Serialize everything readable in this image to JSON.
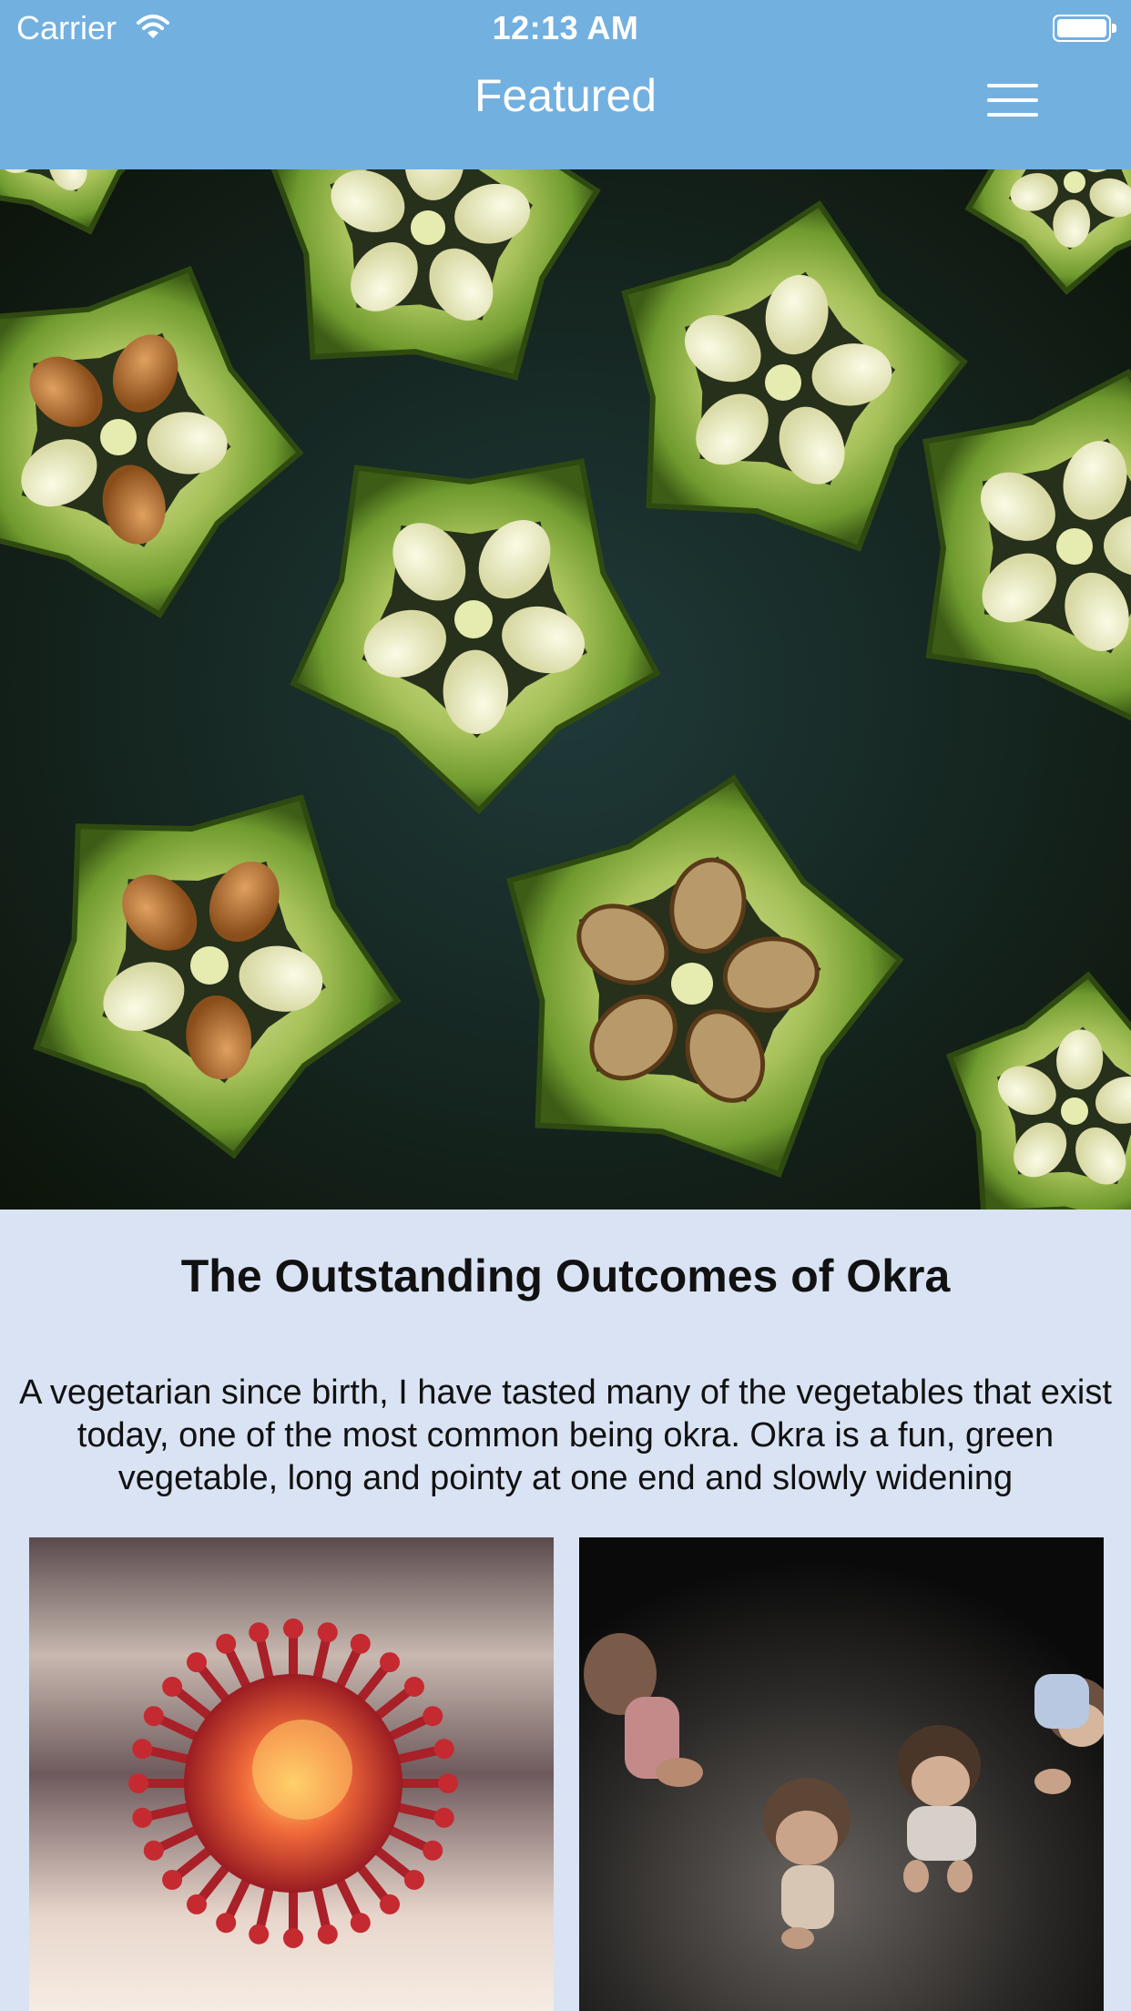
{
  "status_bar": {
    "carrier": "Carrier",
    "time": "12:13 AM",
    "wifi_icon": "wifi-icon",
    "battery_icon": "battery-icon"
  },
  "nav": {
    "title": "Featured",
    "menu_icon": "hamburger-menu-icon"
  },
  "colors": {
    "nav_background": "#72b0e0",
    "page_background": "#d9e3f3",
    "text": "#111111"
  },
  "featured_article": {
    "image_subject": "okra",
    "title": "The Outstanding Outcomes of Okra",
    "excerpt": "A vegetarian since birth, I have tasted many of the vegetables that exist today, one of the most common being okra. Okra is a fun, green vegetable, long and pointy at one end and slowly widening"
  },
  "related_articles": [
    {
      "image_subject": "virus"
    },
    {
      "image_subject": "children"
    }
  ]
}
